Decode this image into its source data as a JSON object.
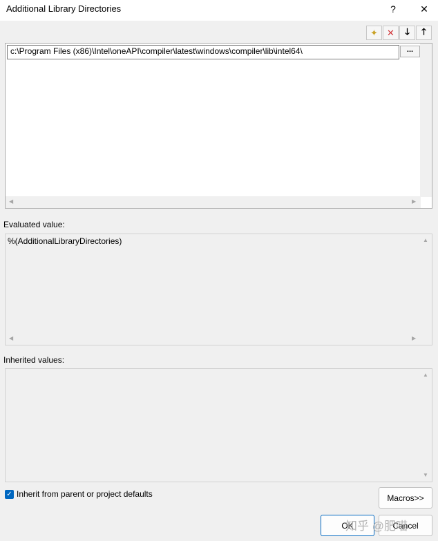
{
  "dialog": {
    "title": "Additional Library Directories",
    "help_glyph": "?",
    "close_glyph": "✕"
  },
  "toolbar": {
    "new_line_icon": "new-folder-icon",
    "delete_icon": "delete-icon",
    "move_down_icon": "arrow-down-icon",
    "move_up_icon": "arrow-up-icon",
    "new_glyph": "✦",
    "delete_glyph": "✕",
    "down_glyph": "🡓",
    "up_glyph": "🡑"
  },
  "entries": {
    "current_value": "c:\\Program Files (x86)\\Intel\\oneAPI\\compiler\\latest\\windows\\compiler\\lib\\intel64\\",
    "browse_label": "..."
  },
  "evaluated": {
    "label": "Evaluated value:",
    "value": "%(AdditionalLibraryDirectories)"
  },
  "inherited": {
    "label": "Inherited values:",
    "value": ""
  },
  "inherit_checkbox": {
    "label": "Inherit from parent or project defaults",
    "checked": true
  },
  "buttons": {
    "macros": "Macros>>",
    "ok": "OK",
    "cancel": "Cancel"
  },
  "watermark": "知乎 @肥喵",
  "colors": {
    "accent": "#0067c0",
    "delete_red": "#d13438"
  }
}
